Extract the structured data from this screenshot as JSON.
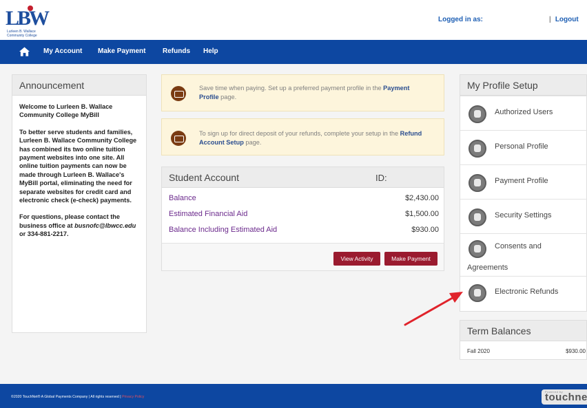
{
  "header": {
    "logo_text": "LBW",
    "logo_subtitle": "Lurleen B. Wallace Community College",
    "logged_in_label": "Logged in as:",
    "logout_label": "Logout",
    "logout_separator": "|"
  },
  "nav": {
    "home_icon": "home-icon",
    "items": [
      {
        "label": "My Account"
      },
      {
        "label": "Make Payment"
      },
      {
        "label": "Refunds"
      },
      {
        "label": "Help"
      }
    ]
  },
  "announcement": {
    "title": "Announcement",
    "paragraph1": "Welcome to Lurleen B. Wallace Community College MyBill",
    "paragraph2": "To better serve students and families, Lurleen B. Wallace Community College has combined its two online tuition payment websites into one site. All online tuition payments can now be made through Lurleen B. Wallace's MyBill portal, eliminating the need for separate websites for credit card and electronic check (e-check) payments.",
    "paragraph3_prefix": "For questions, please contact the business office at ",
    "email": "busnofc@lbwcc.edu",
    "paragraph3_suffix": " or 334-881-2217."
  },
  "notices": [
    {
      "text_before": "Save time when paying. Set up a preferred payment profile in the ",
      "link": "Payment Profile",
      "text_after": " page."
    },
    {
      "text_before": "To sign up for direct deposit of your refunds, complete your setup in the ",
      "link": "Refund Account Setup",
      "text_after": " page."
    }
  ],
  "student_account": {
    "title": "Student Account",
    "id_label": "ID:",
    "rows": [
      {
        "label": "Balance",
        "value": "$2,430.00"
      },
      {
        "label": "Estimated Financial Aid",
        "value": "$1,500.00"
      },
      {
        "label": "Balance Including Estimated Aid",
        "value": "$930.00"
      }
    ],
    "view_activity_label": "View Activity",
    "make_payment_label": "Make Payment"
  },
  "profile_setup": {
    "title": "My Profile Setup",
    "items": [
      {
        "label": "Authorized Users",
        "icon": "users-icon"
      },
      {
        "label": "Personal Profile",
        "icon": "person-icon"
      },
      {
        "label": "Payment Profile",
        "icon": "card-icon"
      },
      {
        "label": "Security Settings",
        "icon": "lock-icon"
      },
      {
        "label": "Consents and",
        "label2": "Agreements",
        "icon": "document-icon"
      },
      {
        "label": "Electronic Refunds",
        "icon": "refund-icon"
      }
    ]
  },
  "term_balances": {
    "title": "Term Balances",
    "rows": [
      {
        "term": "Fall 2020",
        "amount": "$930.00"
      }
    ]
  },
  "footer": {
    "copyright": "©2020 TouchNet® A Global Payments Company | All rights reserved | ",
    "privacy": "Privacy Policy",
    "brand": "touchnet",
    "brand_small": "Powered by"
  },
  "colors": {
    "nav_bg": "#0d47a1",
    "button_bg": "#9a1b2f",
    "notice_bg": "#fdf5dc",
    "link_purple": "#6b2a8c",
    "annotation_arrow": "#e0232b"
  }
}
